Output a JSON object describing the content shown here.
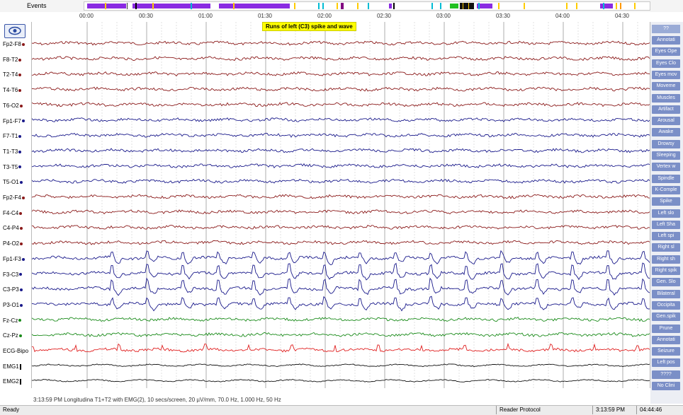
{
  "events": {
    "label": "Events",
    "times": [
      "00:00",
      "00:30",
      "01:00",
      "01:30",
      "02:00",
      "02:30",
      "03:00",
      "03:30",
      "04:00",
      "04:30"
    ]
  },
  "annotation": "Runs of left (C3) spike and wave",
  "channels": [
    {
      "label": "Fp2-F8",
      "color": "#8b1a1a",
      "marker": "dot"
    },
    {
      "label": "F8-T2",
      "color": "#8b1a1a",
      "marker": "dot"
    },
    {
      "label": "T2-T4",
      "color": "#8b1a1a",
      "marker": "dot"
    },
    {
      "label": "T4-T6",
      "color": "#8b1a1a",
      "marker": "dot"
    },
    {
      "label": "T6-O2",
      "color": "#8b1a1a",
      "marker": "dot"
    },
    {
      "label": "Fp1-F7",
      "color": "#1a1a8b",
      "marker": "dot"
    },
    {
      "label": "F7-T1",
      "color": "#1a1a8b",
      "marker": "dot"
    },
    {
      "label": "T1-T3",
      "color": "#1a1a8b",
      "marker": "dot"
    },
    {
      "label": "T3-T5",
      "color": "#1a1a8b",
      "marker": "dot"
    },
    {
      "label": "T5-O1",
      "color": "#1a1a8b",
      "marker": "dot"
    },
    {
      "label": "Fp2-F4",
      "color": "#8b1a1a",
      "marker": "dot"
    },
    {
      "label": "F4-C4",
      "color": "#8b1a1a",
      "marker": "dot"
    },
    {
      "label": "C4-P4",
      "color": "#8b1a1a",
      "marker": "dot"
    },
    {
      "label": "P4-O2",
      "color": "#8b1a1a",
      "marker": "dot"
    },
    {
      "label": "Fp1-F3",
      "color": "#1a1a8b",
      "marker": "dot"
    },
    {
      "label": "F3-C3",
      "color": "#1a1a8b",
      "marker": "dot"
    },
    {
      "label": "C3-P3",
      "color": "#1a1a8b",
      "marker": "dot"
    },
    {
      "label": "P3-O1",
      "color": "#1a1a8b",
      "marker": "dot"
    },
    {
      "label": "Fz-Cz",
      "color": "#1a8b1a",
      "marker": "dot"
    },
    {
      "label": "Cz-Pz",
      "color": "#1a8b1a",
      "marker": "dot"
    },
    {
      "label": "ECG-Bipo",
      "color": "#e02020",
      "marker": "none"
    },
    {
      "label": "EMG1",
      "color": "#111111",
      "marker": "bar"
    },
    {
      "label": "EMG2",
      "color": "#111111",
      "marker": "bar"
    }
  ],
  "footer": "3:13:59 PM Longitudina T1+T2 with EMG(2), 10 secs/screen, 20 µV/mm, 70.0 Hz, 1.000 Hz, 50 Hz",
  "right_top": "??",
  "right_buttons": [
    "Annotati",
    "Eyes Ope",
    "Eyes Clo",
    "Eyes mov",
    "Moveme",
    "Muscles",
    "Artifact",
    "Arousal",
    "Awake",
    "Drowsy",
    "Sleeping",
    "Vertex w",
    "Spindle",
    "K-Comple",
    "Spike",
    "Left slo",
    "Left Sha",
    "Left spi",
    "Right sl",
    "Right sh",
    "Right spik",
    "Gen. Slo",
    "Bilateral",
    "Occipita",
    "Gen.spik",
    "Prune",
    "Annotati",
    "Seizure",
    "Left pos",
    "????",
    "No Clini"
  ],
  "status": {
    "ready": "Ready",
    "protocol": "Reader Protocol",
    "time1": "3:13:59 PM",
    "time2": "04:44:46"
  }
}
